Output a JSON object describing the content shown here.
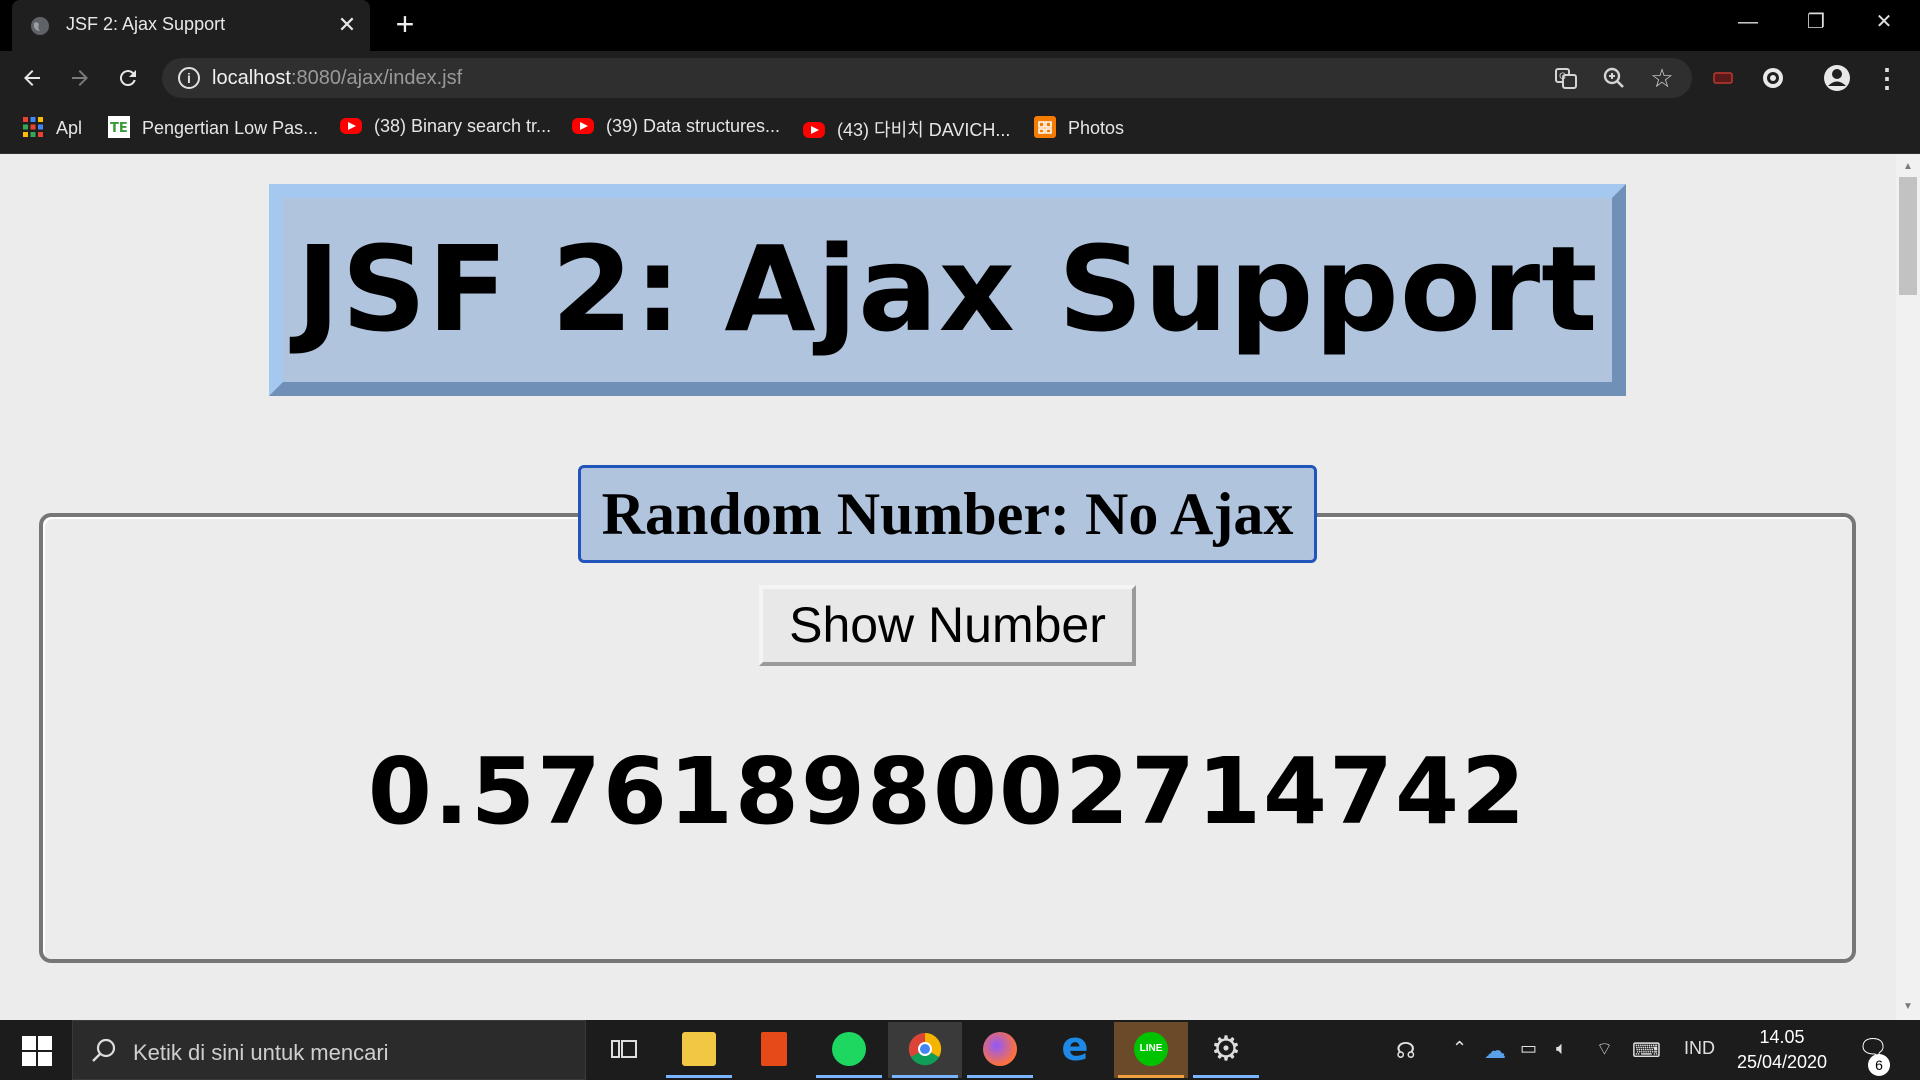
{
  "browser": {
    "tab_title": "JSF 2: Ajax Support",
    "tab_close": "✕",
    "new_tab": "+",
    "url_host": "localhost",
    "url_rest": ":8080/ajax/index.jsf",
    "window_controls": {
      "minimize": "—",
      "restore": "❐",
      "close": "✕"
    },
    "bookmarks": [
      {
        "label": "Apl",
        "icon": "apps-grid-icon"
      },
      {
        "label": "Pengertian Low Pas...",
        "icon": "site-favicon"
      },
      {
        "label": "(38) Binary search tr...",
        "icon": "youtube-icon"
      },
      {
        "label": "(39) Data structures...",
        "icon": "youtube-icon"
      },
      {
        "label": "(43) 다비치 DAVICH...",
        "icon": "youtube-icon"
      },
      {
        "label": "Photos",
        "icon": "photos-icon"
      }
    ]
  },
  "page": {
    "title": "JSF 2: Ajax Support",
    "section_legend": "Random Number: No Ajax",
    "button_label": "Show Number",
    "result_value": "0.5761898002714742"
  },
  "taskbar": {
    "search_placeholder": "Ketik di sini untuk mencari",
    "language": "IND",
    "time": "14.05",
    "date": "25/04/2020",
    "notification_count": "6"
  },
  "colors": {
    "banner_bg": "#b0c4de",
    "legend_border": "#2255bb",
    "page_bg": "#ececec",
    "chrome_dark": "#1f1f1f"
  }
}
